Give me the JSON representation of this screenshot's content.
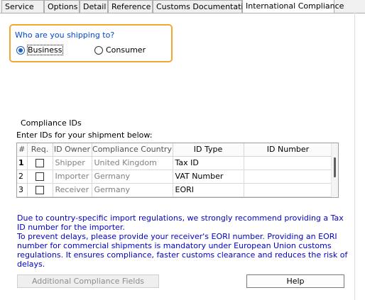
{
  "tabs": [
    {
      "label": "Service"
    },
    {
      "label": "Options"
    },
    {
      "label": "Detail"
    },
    {
      "label": "Reference"
    },
    {
      "label": "Customs Documentation"
    },
    {
      "label": "International Compliance"
    }
  ],
  "shipping": {
    "question": "Who are you shipping to?",
    "options": [
      {
        "label": "Business",
        "selected": true
      },
      {
        "label": "Consumer",
        "selected": false
      }
    ]
  },
  "compliance": {
    "group_title": "Compliance IDs",
    "instruction": "Enter IDs for your shipment below:",
    "columns": [
      "#",
      "Req.",
      "ID Owner",
      "Compliance Country",
      "ID Type",
      "ID Number"
    ],
    "rows": [
      {
        "num": "1",
        "owner": "Shipper",
        "country": "United Kingdom",
        "id_type": "Tax ID",
        "id_number": ""
      },
      {
        "num": "2",
        "owner": "Importer",
        "country": "Germany",
        "id_type": "VAT Number",
        "id_number": ""
      },
      {
        "num": "3",
        "owner": "Receiver",
        "country": "Germany",
        "id_type": "EORI",
        "id_number": ""
      }
    ]
  },
  "notice": {
    "line1": "Due to country-specific import regulations, we strongly recommend providing a Tax ID number for the importer.",
    "line2": "To prevent delays, please provide your receiver's EORI number. Providing an EORI number for commercial shipments is mandatory under European Union customs regulations. It ensures compliance, faster customs clearance and reduces the risk of delays."
  },
  "buttons": {
    "additional": "Additional Compliance Fields",
    "help": "Help"
  },
  "colors": {
    "highlight_border": "#f0a92f",
    "question_text": "#0046d5",
    "notice_text": "#0000c8"
  }
}
